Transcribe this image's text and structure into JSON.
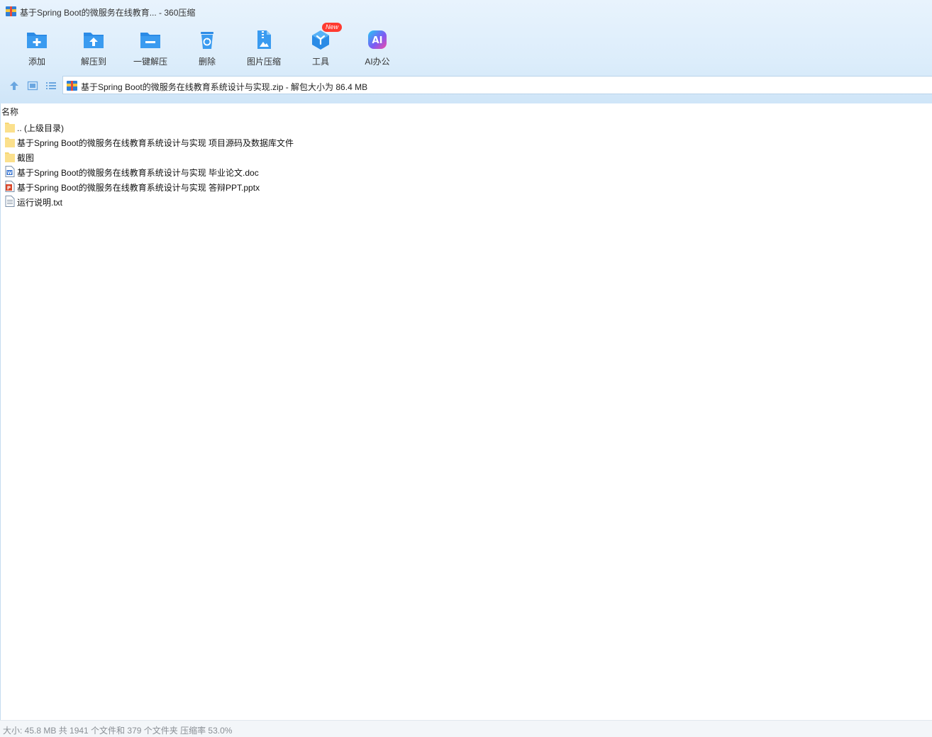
{
  "window": {
    "title": "基于Spring Boot的微服务在线教育... - 360压缩"
  },
  "toolbar": {
    "buttons": [
      {
        "label": "添加",
        "icon": "add-folder-icon"
      },
      {
        "label": "解压到",
        "icon": "extract-to-icon"
      },
      {
        "label": "一键解压",
        "icon": "one-click-extract-icon"
      },
      {
        "label": "删除",
        "icon": "recycle-bin-icon"
      },
      {
        "label": "图片压缩",
        "icon": "image-compress-icon"
      },
      {
        "label": "工具",
        "icon": "tools-cube-icon",
        "badge": "New"
      },
      {
        "label": "AI办公",
        "icon": "ai-office-icon"
      }
    ]
  },
  "address": {
    "text": "基于Spring Boot的微服务在线教育系统设计与实现.zip - 解包大小为 86.4 MB"
  },
  "list": {
    "column_name": "名称",
    "items": [
      {
        "name": ".. (上级目录)",
        "type": "folder"
      },
      {
        "name": "基于Spring Boot的微服务在线教育系统设计与实现 项目源码及数据库文件",
        "type": "folder"
      },
      {
        "name": "截图",
        "type": "folder"
      },
      {
        "name": "基于Spring Boot的微服务在线教育系统设计与实现 毕业论文.doc",
        "type": "doc"
      },
      {
        "name": "基于Spring Boot的微服务在线教育系统设计与实现 答辩PPT.pptx",
        "type": "pptx"
      },
      {
        "name": "运行说明.txt",
        "type": "txt"
      }
    ]
  },
  "status": {
    "text": "大小: 45.8 MB 共 1941 个文件和 379 个文件夹 压缩率 53.0%"
  },
  "colors": {
    "accent": "#2b8be6",
    "folder": "#f7d774",
    "badge": "#ff3b30"
  }
}
